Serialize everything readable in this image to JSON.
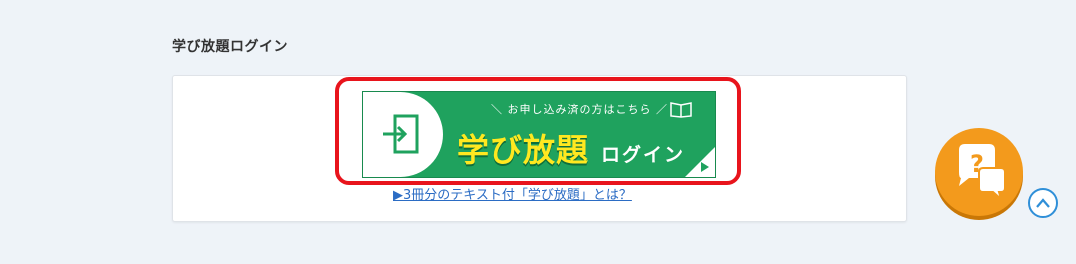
{
  "section": {
    "title": "学び放題ログイン"
  },
  "banner": {
    "note": "＼ お申し込み済の方はこちら ／",
    "brand": "学び放題",
    "login_word": "ログイン",
    "icons": [
      "login-icon",
      "book-icon",
      "play-arrow-icon"
    ]
  },
  "info_link": {
    "label": "▶3冊分のテキスト付「学び放題」とは？"
  },
  "floating": {
    "help_icon": "chat-question-icon",
    "scroll_top_icon": "chevron-up-icon"
  },
  "colors": {
    "banner_green": "#1fa25e",
    "brand_yellow": "#ffe820",
    "highlight_red": "#e8141c",
    "link_blue": "#2b6cc4",
    "help_orange": "#f39a1c"
  }
}
